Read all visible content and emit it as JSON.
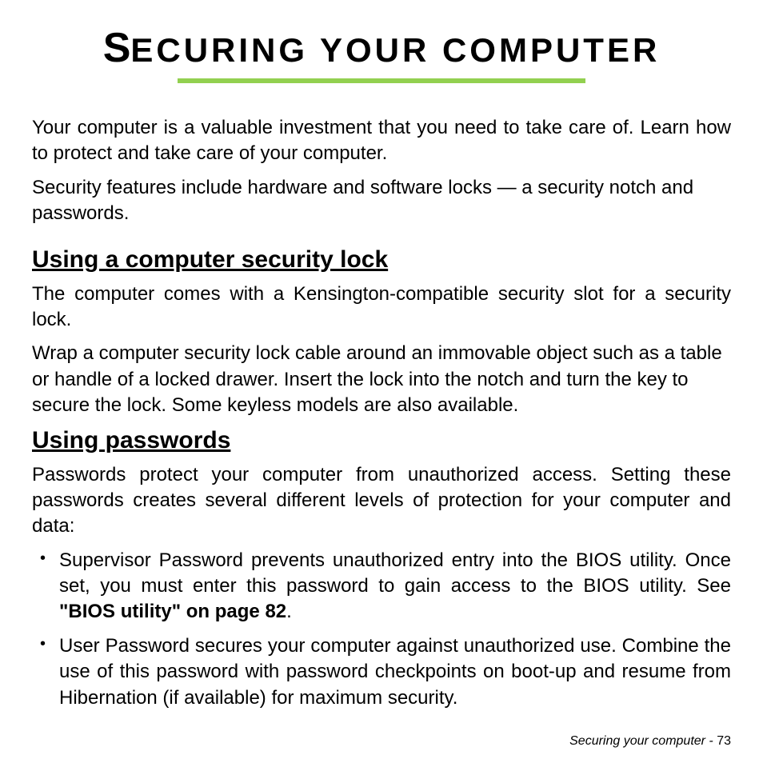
{
  "title_part1": "S",
  "title_part2": "ECURING YOUR COMPUTER",
  "intro1": "Your computer is a valuable investment that you need to take care of. Learn how to protect and take care of your computer.",
  "intro2": "Security features include hardware and software locks — a security notch and passwords.",
  "section1": {
    "heading": "Using a computer security lock",
    "p1": "The computer comes with a Kensington-compatible security slot for a security lock.",
    "p2": "Wrap a computer security lock cable around an immovable object such as a table or handle of a locked drawer. Insert the lock into the notch and turn the key to secure the lock. Some keyless models are also available."
  },
  "section2": {
    "heading": "Using passwords",
    "p1": "Passwords protect your computer from unauthorized access. Setting these passwords creates several different levels of protection for your computer and data:",
    "bullets": [
      {
        "pre": "Supervisor Password prevents unauthorized entry into the BIOS utility. Once set, you must enter this password to gain access to the BIOS utility. See ",
        "bold": "\"BIOS utility\" on page 82",
        "post": "."
      },
      {
        "pre": "User Password secures your computer against unauthorized use. Combine the use of this password with password checkpoints on boot-up and resume from Hibernation (if available) for maximum security.",
        "bold": "",
        "post": ""
      }
    ]
  },
  "footer": {
    "label": "Securing your computer -  ",
    "page": "73"
  }
}
